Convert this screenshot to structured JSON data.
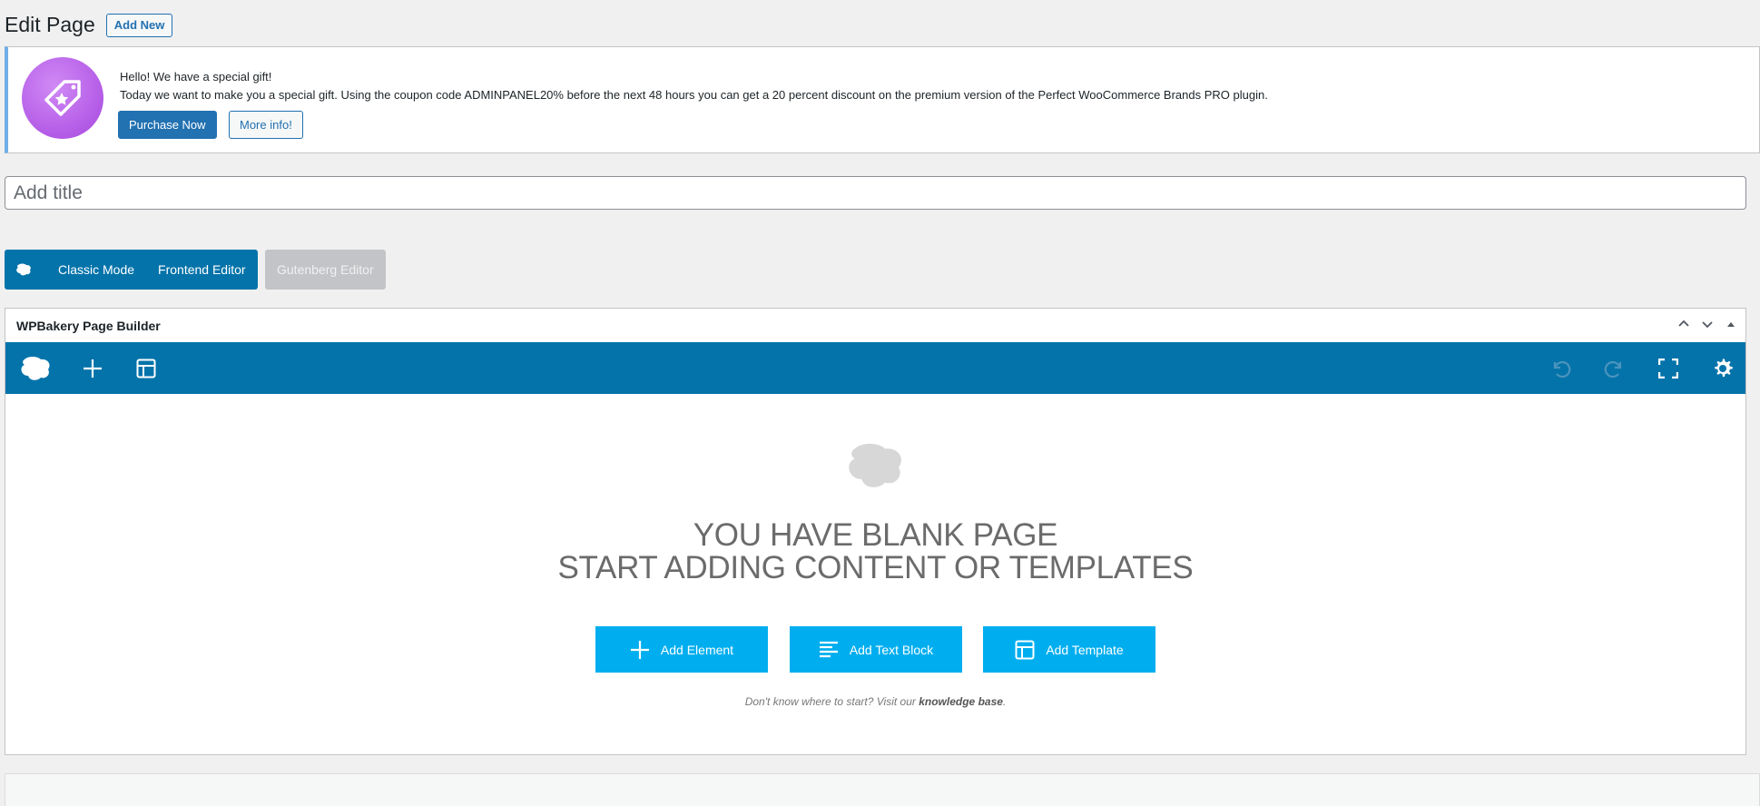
{
  "header": {
    "title": "Edit Page",
    "add_new_label": "Add New"
  },
  "notice": {
    "title": "Hello! We have a special gift!",
    "body": "Today we want to make you a special gift. Using the coupon code ADMINPANEL20% before the next 48 hours you can get a 20 percent discount on the premium version of the Perfect WooCommerce Brands PRO plugin.",
    "purchase_label": "Purchase Now",
    "more_info_label": "More info!",
    "logo_icon": "tag-star-icon"
  },
  "title_field": {
    "placeholder": "Add title",
    "value": ""
  },
  "editor_switch": {
    "classic_label": "Classic Mode",
    "frontend_label": "Frontend Editor",
    "gutenberg_label": "Gutenberg Editor"
  },
  "wpbakery": {
    "title": "WPBakery Page Builder",
    "empty_line1": "YOU HAVE BLANK PAGE",
    "empty_line2": "START ADDING CONTENT OR TEMPLATES",
    "add_element_label": "Add Element",
    "add_text_block_label": "Add Text Block",
    "add_template_label": "Add Template",
    "help_prefix": "Don't know where to start? Visit our ",
    "help_link": "knowledge base",
    "help_suffix": "."
  },
  "colors": {
    "toolbar": "#0473aa",
    "action_button": "#00aeef",
    "primary": "#2271b1",
    "notice_border": "#72aee6"
  }
}
